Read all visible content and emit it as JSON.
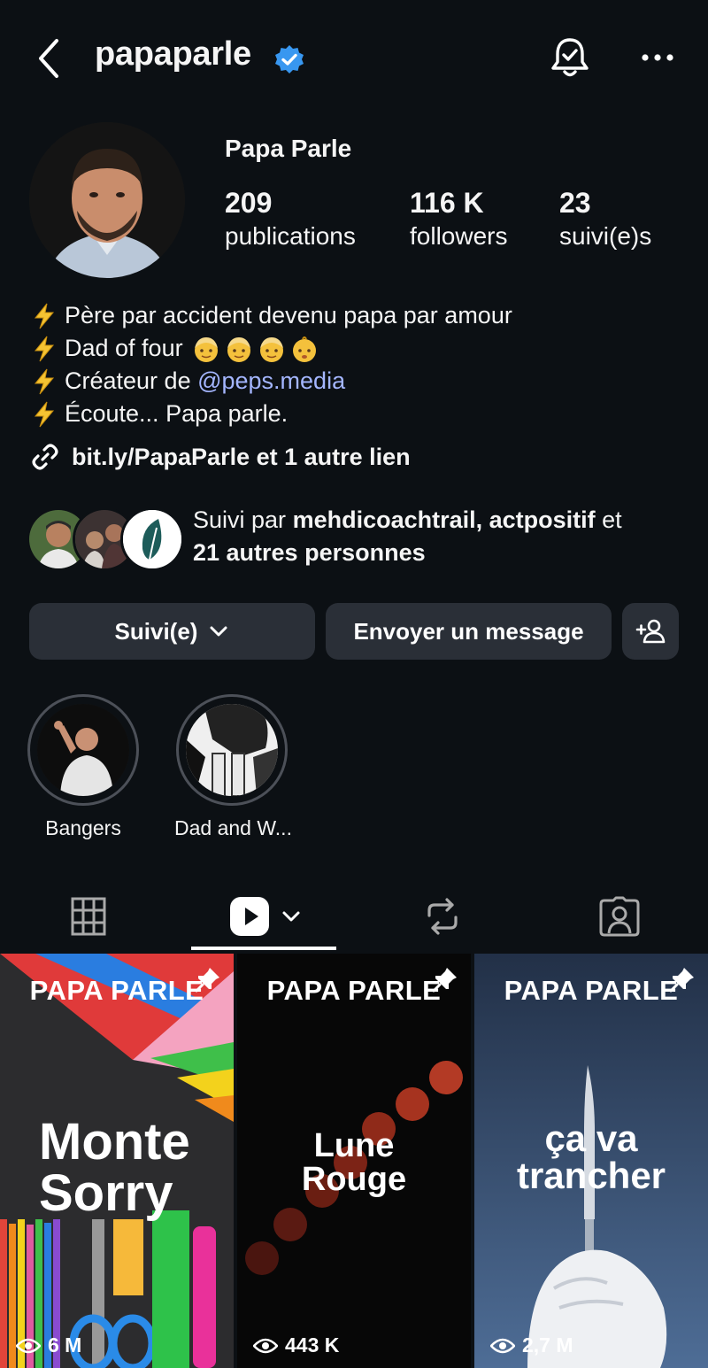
{
  "header": {
    "username": "papaparle"
  },
  "profile": {
    "display_name": "Papa Parle",
    "stats": [
      {
        "value": "209",
        "label": "publications"
      },
      {
        "value": "116 K",
        "label": "followers"
      },
      {
        "value": "23",
        "label": "suivi(e)s"
      }
    ],
    "bio": {
      "line1": "Père par accident devenu papa par amour",
      "line2": "Dad of four",
      "line3_prefix": "Créateur de ",
      "line3_mention": "@peps.media",
      "line4": "Écoute... Papa parle."
    },
    "link": "bit.ly/PapaParle et 1 autre lien",
    "followed_by": {
      "prefix": "Suivi par ",
      "names": "mehdicoachtrail, actpositif",
      "mid": " et",
      "others": "21 autres personnes"
    }
  },
  "actions": {
    "follow_label": "Suivi(e)",
    "message_label": "Envoyer un message"
  },
  "highlights": [
    {
      "label": "Bangers"
    },
    {
      "label": "Dad and W..."
    }
  ],
  "tabs": [
    {
      "icon": "grid-icon"
    },
    {
      "icon": "reels-icon"
    },
    {
      "icon": "repost-icon"
    },
    {
      "icon": "tagged-icon"
    }
  ],
  "reels": [
    {
      "brand": "PAPA PARLE",
      "title_1": "Monte",
      "title_2": "Sorry",
      "views": "6 M"
    },
    {
      "brand": "PAPA PARLE",
      "title_1": "Lune",
      "title_2": "Rouge",
      "views": "443 K"
    },
    {
      "brand": "PAPA PARLE",
      "title_1": "ça va",
      "title_2": "trancher",
      "views": "2,7 M"
    }
  ],
  "colors": {
    "background": "#0c1014",
    "button": "#2a2f37",
    "verified": "#3897f0",
    "mention": "#a4b6ff"
  }
}
